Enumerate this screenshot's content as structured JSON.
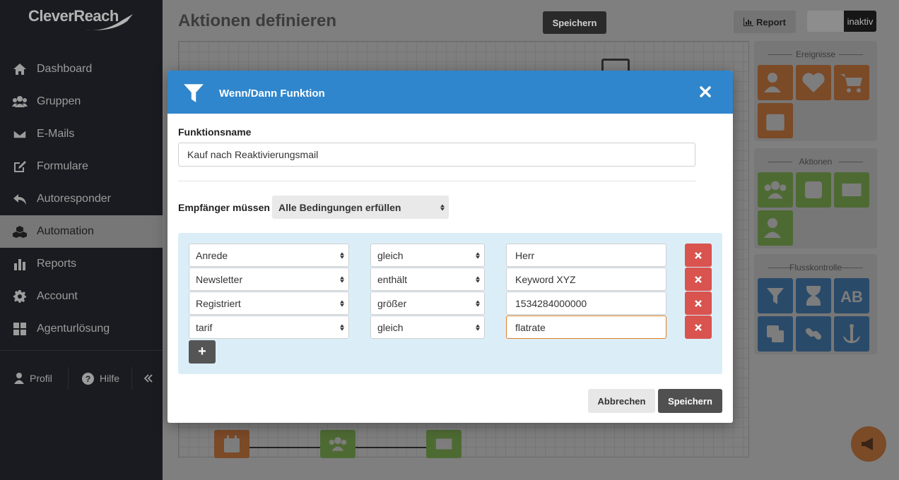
{
  "app": {
    "logo_text": "CleverReach"
  },
  "sidebar": {
    "items": [
      {
        "label": "Dashboard",
        "icon": "home-icon"
      },
      {
        "label": "Gruppen",
        "icon": "users-icon"
      },
      {
        "label": "E-Mails",
        "icon": "envelope-icon"
      },
      {
        "label": "Formulare",
        "icon": "edit-icon"
      },
      {
        "label": "Autoresponder",
        "icon": "reply-icon"
      },
      {
        "label": "Automation",
        "icon": "cubes-icon",
        "active": true
      },
      {
        "label": "Reports",
        "icon": "bar-chart-icon"
      },
      {
        "label": "Account",
        "icon": "gear-icon"
      },
      {
        "label": "Agenturlösung",
        "icon": "grid-icon"
      }
    ],
    "footer": {
      "profile": "Profil",
      "help": "Hilfe"
    }
  },
  "header": {
    "title": "Aktionen definieren",
    "save_label": "Speichern",
    "report_label": "Report",
    "status_label": "inaktiv"
  },
  "palettes": {
    "events_title": "Ereignisse",
    "actions_title": "Aktionen",
    "flow_title": "Flusskontrolle"
  },
  "modal": {
    "title": "Wenn/Dann Funktion",
    "function_name_label": "Funktionsname",
    "function_name_value": "Kauf nach Reaktivierungsmail",
    "recipients_label": "Empfänger müssen",
    "recipients_mode": "Alle Bedingungen erfüllen",
    "conditions": [
      {
        "field": "Anrede",
        "operator": "gleich",
        "value": "Herr"
      },
      {
        "field": "Newsletter",
        "operator": "enthält",
        "value": "Keyword XYZ"
      },
      {
        "field": "Registriert",
        "operator": "größer",
        "value": "1534284000000"
      },
      {
        "field": "tarif",
        "operator": "gleich",
        "value": "flatrate"
      }
    ],
    "add_label": "+",
    "cancel_label": "Abbrechen",
    "save_label": "Speichern"
  },
  "colors": {
    "modal_header": "#2f86cc",
    "delete_red": "#d9534f",
    "condition_bg": "#dbeef8",
    "focus_orange": "#e67e22"
  }
}
